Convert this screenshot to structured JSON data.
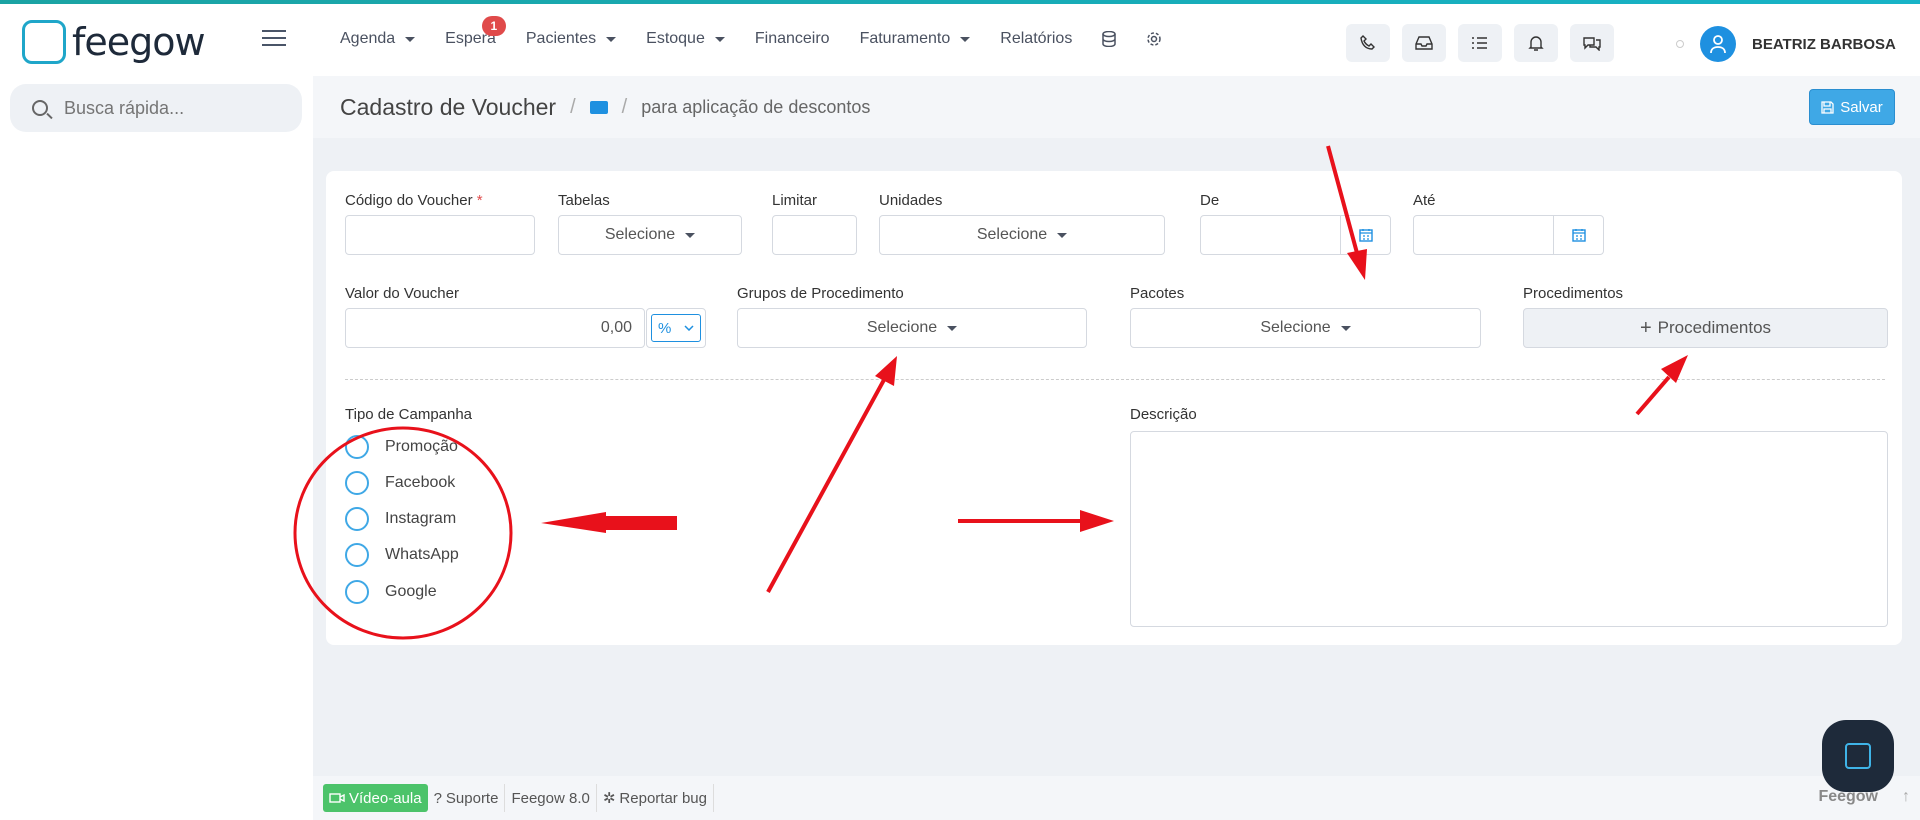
{
  "brand": {
    "name": "feegow"
  },
  "nav": {
    "items": [
      {
        "label": "Agenda",
        "caret": true
      },
      {
        "label": "Espera",
        "caret": false,
        "badge": "1"
      },
      {
        "label": "Pacientes",
        "caret": true
      },
      {
        "label": "Estoque",
        "caret": true
      },
      {
        "label": "Financeiro",
        "caret": false
      },
      {
        "label": "Faturamento",
        "caret": true
      },
      {
        "label": "Relatórios",
        "caret": false
      }
    ],
    "icon_buttons": [
      "phone-icon",
      "inbox-icon",
      "checklist-icon",
      "bell-icon",
      "chat-icon"
    ],
    "user_name": "BEATRIZ BARBOSA"
  },
  "search": {
    "placeholder": "Busca rápida..."
  },
  "page": {
    "title": "Cadastro de Voucher",
    "breadcrumb": "para aplicação de descontos",
    "save_label": "Salvar"
  },
  "form": {
    "codigo_label": "Código do Voucher",
    "required_mark": "*",
    "tabelas_label": "Tabelas",
    "tabelas_value": "Selecione",
    "limitar_label": "Limitar",
    "unidades_label": "Unidades",
    "unidades_value": "Selecione",
    "de_label": "De",
    "ate_label": "Até",
    "valor_label": "Valor do Voucher",
    "valor_value": "0,00",
    "valor_unit": "%",
    "grupos_label": "Grupos de Procedimento",
    "grupos_value": "Selecione",
    "pacotes_label": "Pacotes",
    "pacotes_value": "Selecione",
    "procedimentos_label": "Procedimentos",
    "procedimentos_button": "Procedimentos",
    "campanha_label": "Tipo de Campanha",
    "campanha_options": [
      "Promoção",
      "Facebook",
      "Instagram",
      "WhatsApp",
      "Google"
    ],
    "descricao_label": "Descrição"
  },
  "footer": {
    "video": "Vídeo-aula",
    "suporte": "Suporte",
    "version": "Feegow 8.0",
    "bug": "Reportar bug",
    "brand": "Feegow"
  },
  "annotations_color": "#e8111b"
}
